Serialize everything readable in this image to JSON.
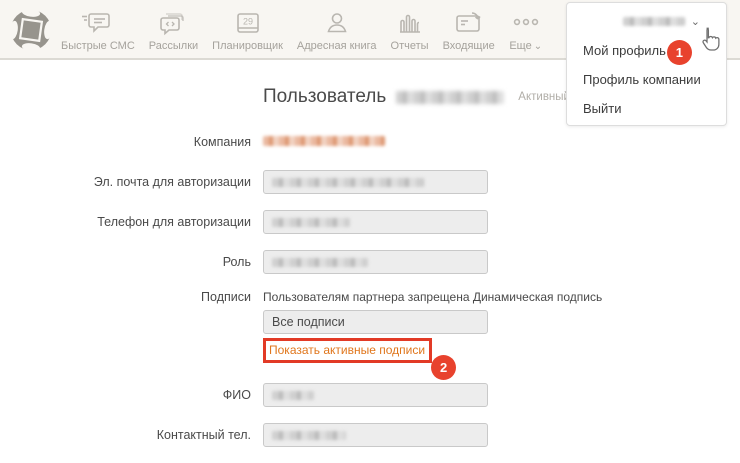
{
  "icons": {
    "chevron_down": "⌄"
  },
  "header": {
    "nav": [
      {
        "label": "Быстрые СМС",
        "icon": "quick-sms-icon"
      },
      {
        "label": "Рассылки",
        "icon": "mailings-icon"
      },
      {
        "label": "Планировщик",
        "icon": "scheduler-icon",
        "day": "29"
      },
      {
        "label": "Адресная книга",
        "icon": "address-book-icon"
      },
      {
        "label": "Отчеты",
        "icon": "reports-icon"
      },
      {
        "label": "Входящие",
        "icon": "inbox-icon"
      },
      {
        "label": "Еще",
        "icon": "more-icon"
      }
    ]
  },
  "user_menu": {
    "items": [
      {
        "label": "Мой профиль",
        "badge": "1"
      },
      {
        "label": "Профиль компании"
      },
      {
        "label": "Выйти"
      }
    ]
  },
  "page": {
    "title": "Пользователь",
    "status": "Активный"
  },
  "form": {
    "company_label": "Компания",
    "email_label": "Эл. почта для авторизации",
    "phone_label": "Телефон для авторизации",
    "role_label": "Роль",
    "signatures_label": "Подписи",
    "signatures_note": "Пользователям партнера запрещена Динамическая подпись",
    "signatures_value": "Все подписи",
    "signatures_link": "Показать активные подписи",
    "signatures_badge": "2",
    "fio_label": "ФИО",
    "contact_label": "Контактный тел."
  }
}
